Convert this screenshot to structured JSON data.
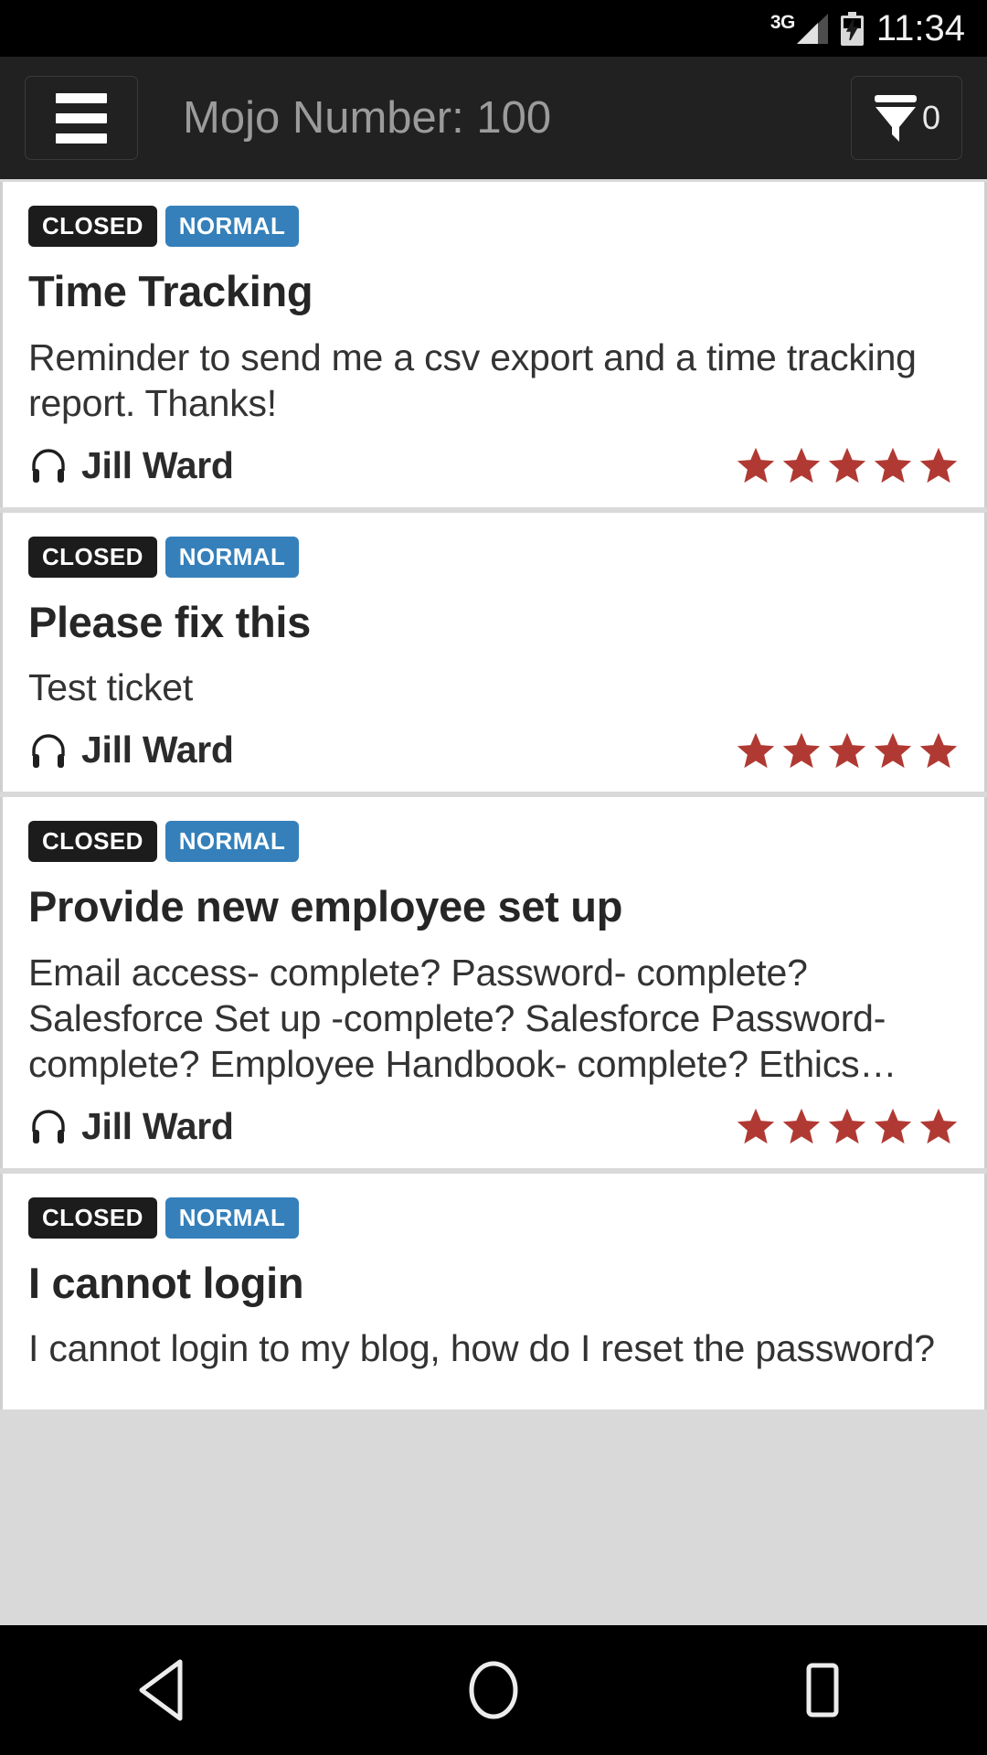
{
  "status_bar": {
    "network_label": "3G",
    "network_icon": "signal-3g-icon",
    "battery_icon": "battery-charging-icon",
    "time": "11:34"
  },
  "app_bar": {
    "menu_icon": "hamburger-menu-icon",
    "title": "Mojo Number: 100",
    "filter_icon": "funnel-filter-icon",
    "filter_count": "0"
  },
  "tickets": [
    {
      "status": "CLOSED",
      "priority": "NORMAL",
      "title": "Time Tracking",
      "body": "Reminder to send me a csv export and a time tracking report.  Thanks!",
      "agent": "Jill Ward",
      "agent_icon": "headset-icon",
      "rating": 5
    },
    {
      "status": "CLOSED",
      "priority": "NORMAL",
      "title": "Please fix this",
      "body": "Test ticket",
      "agent": "Jill Ward",
      "agent_icon": "headset-icon",
      "rating": 5
    },
    {
      "status": "CLOSED",
      "priority": "NORMAL",
      "title": "Provide new employee set up",
      "body": "Email access- complete? Password- complete? Salesforce Set up -complete? Salesforce Password- complete? Employee Handbook- complete?  Ethics…",
      "agent": "Jill Ward",
      "agent_icon": "headset-icon",
      "rating": 5
    },
    {
      "status": "CLOSED",
      "priority": "NORMAL",
      "title": "I cannot login",
      "body": "I cannot login to my blog, how do I reset the password?",
      "agent": "",
      "agent_icon": "",
      "rating": 0
    }
  ],
  "nav_bar": {
    "back_icon": "back-triangle-icon",
    "home_icon": "home-circle-icon",
    "recents_icon": "recents-square-icon"
  },
  "colors": {
    "status_badge": "#1c1c1c",
    "priority_badge": "#3580ba",
    "star": "#b03a33",
    "app_bar": "#212121",
    "app_bar_title": "#9b9b9b"
  }
}
